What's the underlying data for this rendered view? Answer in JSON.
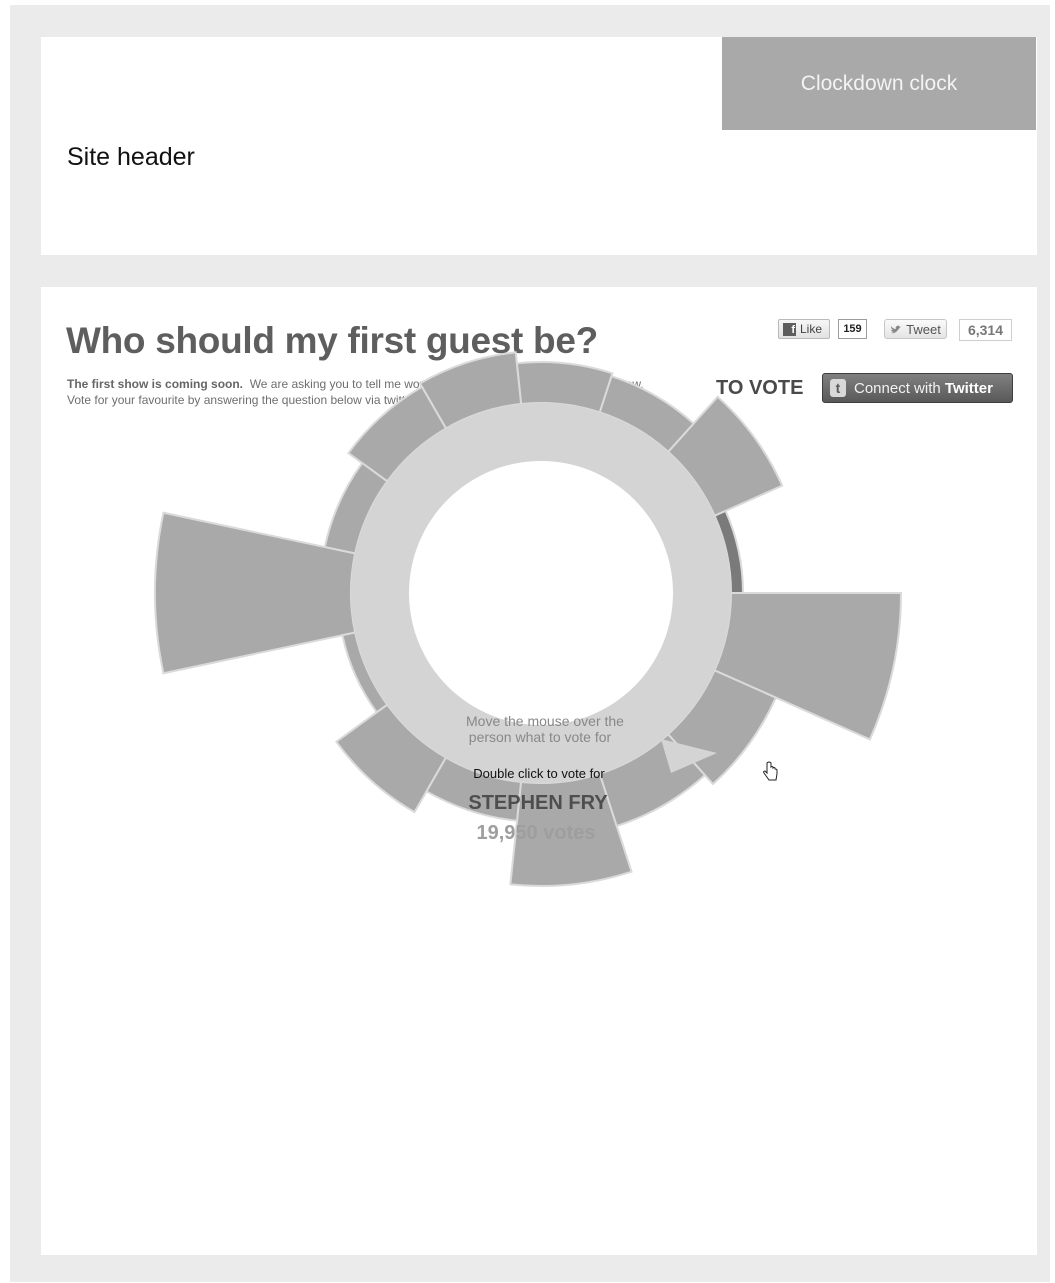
{
  "header": {
    "title": "Site header",
    "clock_label": "Clockdown clock"
  },
  "main": {
    "title": "Who should my first guest be?",
    "intro_bold": "The first show is coming soon.",
    "intro_line1": "We are asking you to tell me would you would like to see on the first show.",
    "intro_line2": "Vote for your favourite by answering the question below via twitter by tweeting your favourites @ConanOBrien."
  },
  "social": {
    "like_label": "Like",
    "like_count": "159",
    "tweet_label": "Tweet",
    "tweet_count": "6,314"
  },
  "vote": {
    "to_vote_label": "TO VOTE",
    "connect_prefix": "Connect with",
    "connect_brand": "Twitter"
  },
  "wheel": {
    "instruction_line1": "Move the mouse over the",
    "instruction_line2": "person what to vote for",
    "double_click_label": "Double click to vote for",
    "selected_name": "STEPHEN FRY",
    "selected_votes": "19,950 votes"
  },
  "colors": {
    "segment": "#a9a9a9",
    "segment_active": "#7a7a7a",
    "ring": "#d4d4d4",
    "frame": "#ebebeb",
    "clock": "#a9a9a9"
  },
  "icons": [
    "facebook-icon",
    "twitter-bird-icon",
    "twitter-t-icon",
    "hand-cursor-icon"
  ],
  "chart_data": {
    "type": "radial-bar",
    "segments": [
      {
        "value": 12,
        "active": true
      },
      {
        "value": 74
      },
      {
        "value": 38
      },
      {
        "value": 41
      },
      {
        "value": 52
      },
      {
        "value": 48
      },
      {
        "value": 31
      },
      {
        "value": 196
      },
      {
        "value": 13
      },
      {
        "value": 63
      },
      {
        "value": 39
      },
      {
        "value": 103
      },
      {
        "value": 55
      },
      {
        "value": 67
      },
      {
        "value": 170
      }
    ]
  }
}
